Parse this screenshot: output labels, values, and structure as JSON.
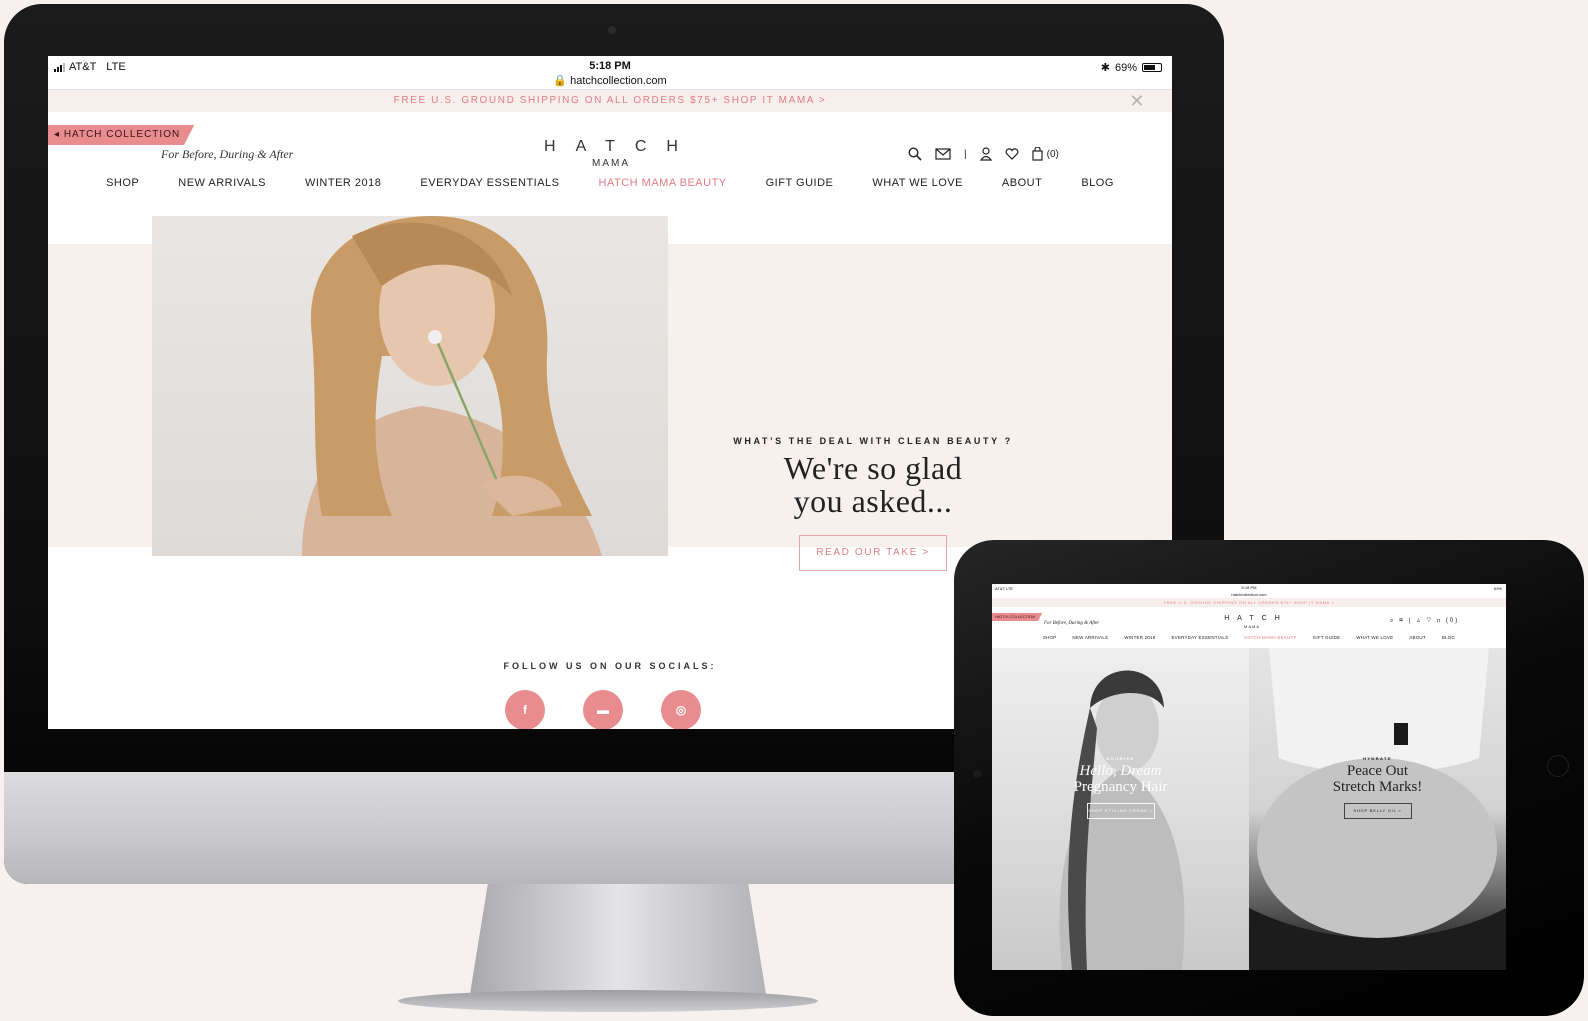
{
  "desktop": {
    "status_bar": {
      "carrier": "AT&T",
      "network": "LTE",
      "time": "5:18 PM",
      "url": "hatchcollection.com",
      "battery": "69%",
      "battery_level": 0.69
    },
    "promo": {
      "text": "FREE U.S. GROUND SHIPPING ON ALL ORDERS $75+ SHOP IT MAMA >",
      "close_icon": "close-icon"
    },
    "header": {
      "collection_tag": "HATCH COLLECTION",
      "tagline": "For Before, During & After",
      "logo_main": "HATCH",
      "logo_sub": "MAMA",
      "bag_count": "(0)",
      "icons": [
        "search-icon",
        "mail-icon",
        "account-icon",
        "heart-icon",
        "bag-icon"
      ]
    },
    "nav": [
      "SHOP",
      "NEW ARRIVALS",
      "WINTER 2018",
      "EVERYDAY ESSENTIALS",
      "HATCH MAMA BEAUTY",
      "GIFT GUIDE",
      "WHAT WE LOVE",
      "ABOUT",
      "BLOG"
    ],
    "hero": {
      "eyebrow": "WHAT’S THE DEAL WITH CLEAN BEAUTY ?",
      "headline_line1": "We're so glad",
      "headline_line2": "you asked...",
      "cta": "READ OUR TAKE >"
    },
    "socials": {
      "title": "FOLLOW US ON OUR SOCIALS:",
      "icons": [
        "facebook-icon",
        "chat-icon",
        "instagram-icon"
      ]
    }
  },
  "tablet": {
    "status_bar": {
      "carrier": "AT&T",
      "network": "LTE",
      "time": "5:18 PM",
      "url": "hatchcollection.com",
      "battery": "69%"
    },
    "promo": "FREE U.S. GROUND SHIPPING ON ALL ORDERS $75+ SHOP IT MAMA >",
    "header": {
      "collection_tag": "HATCH COLLECTION",
      "tagline": "For Before, During & After",
      "logo_main": "HATCH",
      "logo_sub": "MAMA",
      "bag_count": "(0)"
    },
    "nav": [
      "SHOP",
      "NEW ARRIVALS",
      "WINTER 2018",
      "EVERYDAY ESSENTIALS",
      "HATCH MAMA BEAUTY",
      "GIFT GUIDE",
      "WHAT WE LOVE",
      "ABOUT",
      "BLOG"
    ],
    "panels": [
      {
        "eyebrow": "NOURISH",
        "headline_line1": "Hello, Dream",
        "headline_line2": "Pregnancy Hair",
        "cta": "SHOP STYLING CRÈME >"
      },
      {
        "eyebrow": "HYDRATE",
        "headline_line1": "Peace Out",
        "headline_line2": "Stretch Marks!",
        "cta": "SHOP BELLY OIL >"
      }
    ]
  },
  "colors": {
    "accent": "#e07e84",
    "tag": "#e98c8f",
    "hero_bg": "#f7f1ee"
  }
}
